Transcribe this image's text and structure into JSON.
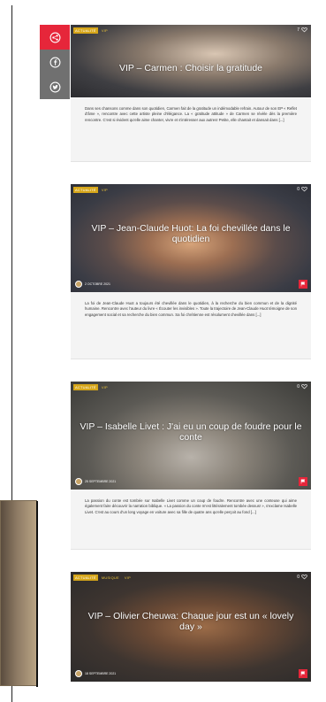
{
  "share": {
    "items": [
      {
        "name": "share-toggle",
        "icon": "share-icon"
      },
      {
        "name": "facebook-share",
        "icon": "facebook-icon"
      },
      {
        "name": "twitter-share",
        "icon": "twitter-icon"
      }
    ]
  },
  "posts": [
    {
      "categories": [
        "ACTUALITÉ",
        "VIP"
      ],
      "likes": "7",
      "title": "VIP – Carmen : Choisir la gratitude",
      "date": "",
      "excerpt": "Dans ses chansons comme dans son quotidien, Carmen fait de la gratitude un indémodable refrain. Autour de son EP « Reflet d'âme », rencontre avec cette artiste pleine d'élégance. La « gratitude attitude » de Carmen se révèle dès la première rencontre. C'est si évident qu'elle aime chanter, vivre et s'intéresser aux autres! Petite, elle chantait et dansait dans [...]"
    },
    {
      "categories": [
        "ACTUALITÉ",
        "VIP"
      ],
      "likes": "0",
      "title": "VIP – Jean-Claude Huot: La foi chevillée dans le quotidien",
      "date": "2 OCTOBRE 2021",
      "excerpt": "La foi de Jean-Claude Huot a toujours été chevillée dans le quotidien, à la recherche du bien commun et de la dignité humaine. Rencontre avec l'auteur du livre « Écouter les invisibles ». Toute la trajectoire de Jean-Claude Huot témoigne de son engagement social et sa recherche du bien commun. Sa foi chrétienne est résolument chevillée dans [...]"
    },
    {
      "categories": [
        "ACTUALITÉ",
        "VIP"
      ],
      "likes": "0",
      "title": "VIP – Isabelle Livet : J'ai eu un coup de foudre pour le conte",
      "date": "25 SEPTEMBRE 2021",
      "excerpt": "La passion du conte est tombée sur Isabelle Livet comme un coup de foudre. Rencontre avec une conteuse qui aime également faire découvrir la narration biblique. « La passion du conte m'est littéralement tombée dessus! », s'exclame Isabelle Livet. C'est au cours d'un long voyage en voiture avec sa fille de quatre ans qu'elle perçoit au fond [...]"
    },
    {
      "categories": [
        "ACTUALITÉ",
        "MUSIQUE",
        "VIP"
      ],
      "likes": "0",
      "title": "VIP – Olivier Cheuwa: Chaque jour est un « lovely day »",
      "date": "18 SEPTEMBRE 2021",
      "excerpt": ""
    }
  ],
  "colors": {
    "accent": "#e6263a",
    "category": "#d6a619",
    "share_sub": "#707070"
  }
}
